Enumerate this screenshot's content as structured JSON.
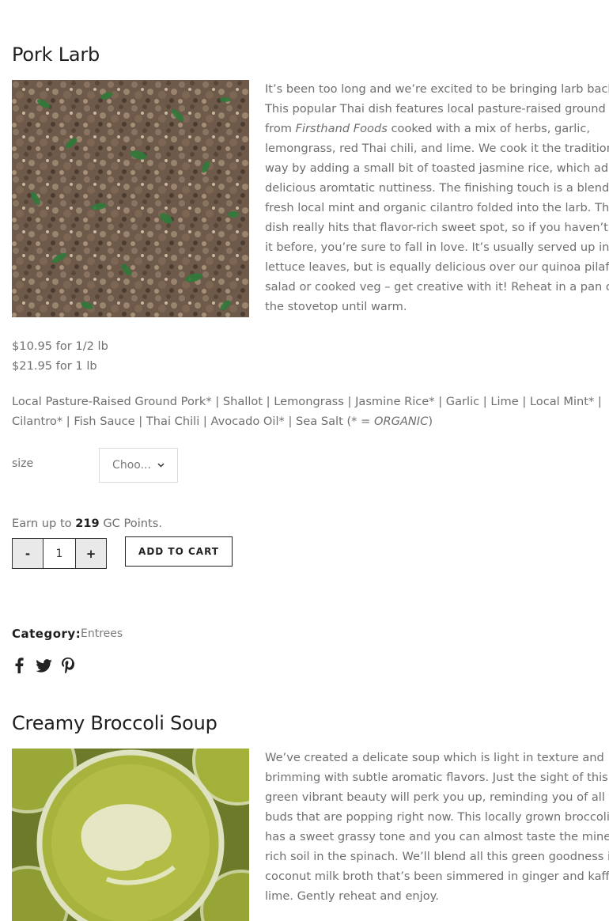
{
  "product1": {
    "title": "Pork Larb",
    "description_lines": [
      [
        "It’s been too long and we’re excited to be bringing larb back on!"
      ],
      [
        "This popular Thai dish features local pasture-raised ground pork"
      ],
      [
        "from ",
        {
          "em": "Firsthand Foods"
        },
        " cooked with a mix of herbs, garlic,"
      ],
      [
        "lemongrass, red Thai chili, and lime. We cook it the traditional"
      ],
      [
        "way by adding a small bit of toasted jasmine rice, which adds a"
      ],
      [
        "delicious aromtatic nuttiness. The finishing touch is a blend of"
      ],
      [
        "fresh local mint and organic cilantro folded into the larb. This"
      ],
      [
        "dish really hits that flavor-rich sweet spot, so if you haven’t tried"
      ],
      [
        "it before, you’re sure to fall in love. It’s usually served up in"
      ],
      [
        "lettuce leaves, but is equally delicious over our quinoa pilaf,"
      ],
      [
        "salad or cooked veg – get creative with it! Reheat in a pan on"
      ],
      [
        "the stovetop until warm."
      ]
    ],
    "price_half": "$10.95 for 1/2 lb",
    "price_full": "$21.95 for 1 lb",
    "ingredients_line1": "Local Pasture-Raised Ground Pork* | Shallot | Lemongrass | Jasmine Rice* | Garlic | Lime | Local Mint* |",
    "ingredients_line2_start": "Cilantro* | Fish Sauce | Thai Chili | Avocado Oil* | Sea Salt (* = ",
    "ingredients_organic": "ORGANIC",
    "ingredients_line2_end": ")",
    "size_label": "size",
    "size_select_value": "Choo...",
    "points_prefix": "Earn up to ",
    "points_value": "219",
    "points_suffix": " GC Points.",
    "qty_minus": "-",
    "qty_value": "1",
    "qty_plus": "+",
    "add_to_cart": "ADD TO CART",
    "category_label": "Category:",
    "category_value": "Entrees",
    "share_icons": [
      "facebook-icon",
      "twitter-icon",
      "pinterest-icon"
    ]
  },
  "product2": {
    "title": "Creamy Broccoli Soup",
    "description_lines": [
      [
        "We’ve created a delicate soup which is light in texture and"
      ],
      [
        "brimming with subtle aromatic flavors. Just the sight of this"
      ],
      [
        "green vibrant beauty will perk you up, reminding you of all the"
      ],
      [
        "buds that are popping right now. This locally grown broccoli"
      ],
      [
        "has a sweet grassy tone and you can almost taste the mineral"
      ],
      [
        "rich soil in the spinach. We’ll blend all this green goodness in a"
      ],
      [
        "coconut milk broth that’s been simmered in ginger and kaffir"
      ],
      [
        "lime. Gently reheat and enjoy."
      ]
    ]
  },
  "colors": {
    "text": "#6f6f6f",
    "heading": "#1e1e1e",
    "qty_bg": "#e9e9e9"
  }
}
